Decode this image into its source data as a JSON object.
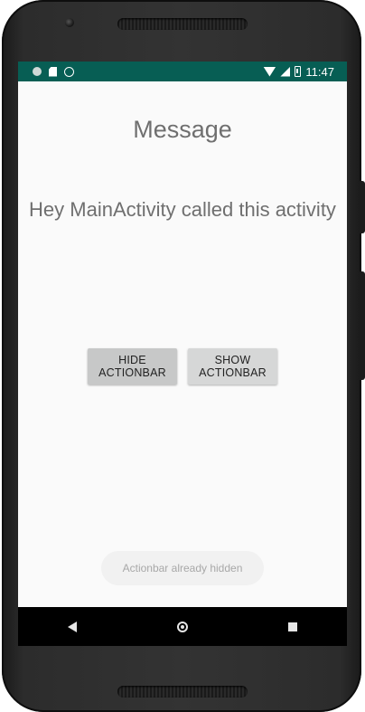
{
  "status_bar": {
    "time": "11:47",
    "icons": [
      "notification-dot-icon",
      "sd-card-icon",
      "whatsapp-icon",
      "wifi-icon",
      "signal-icon",
      "battery-icon"
    ],
    "color": "#075e54"
  },
  "screen": {
    "title": "Message",
    "message": "Hey MainActivity called this activity"
  },
  "buttons": {
    "hide_label_line1": "HIDE",
    "hide_label_line2": "ACTIONBAR",
    "show_label_line1": "SHOW",
    "show_label_line2": "ACTIONBAR"
  },
  "toast": {
    "text": "Actionbar already hidden"
  },
  "nav_bar": {
    "icons": [
      "back-icon",
      "home-icon",
      "recents-icon"
    ]
  }
}
